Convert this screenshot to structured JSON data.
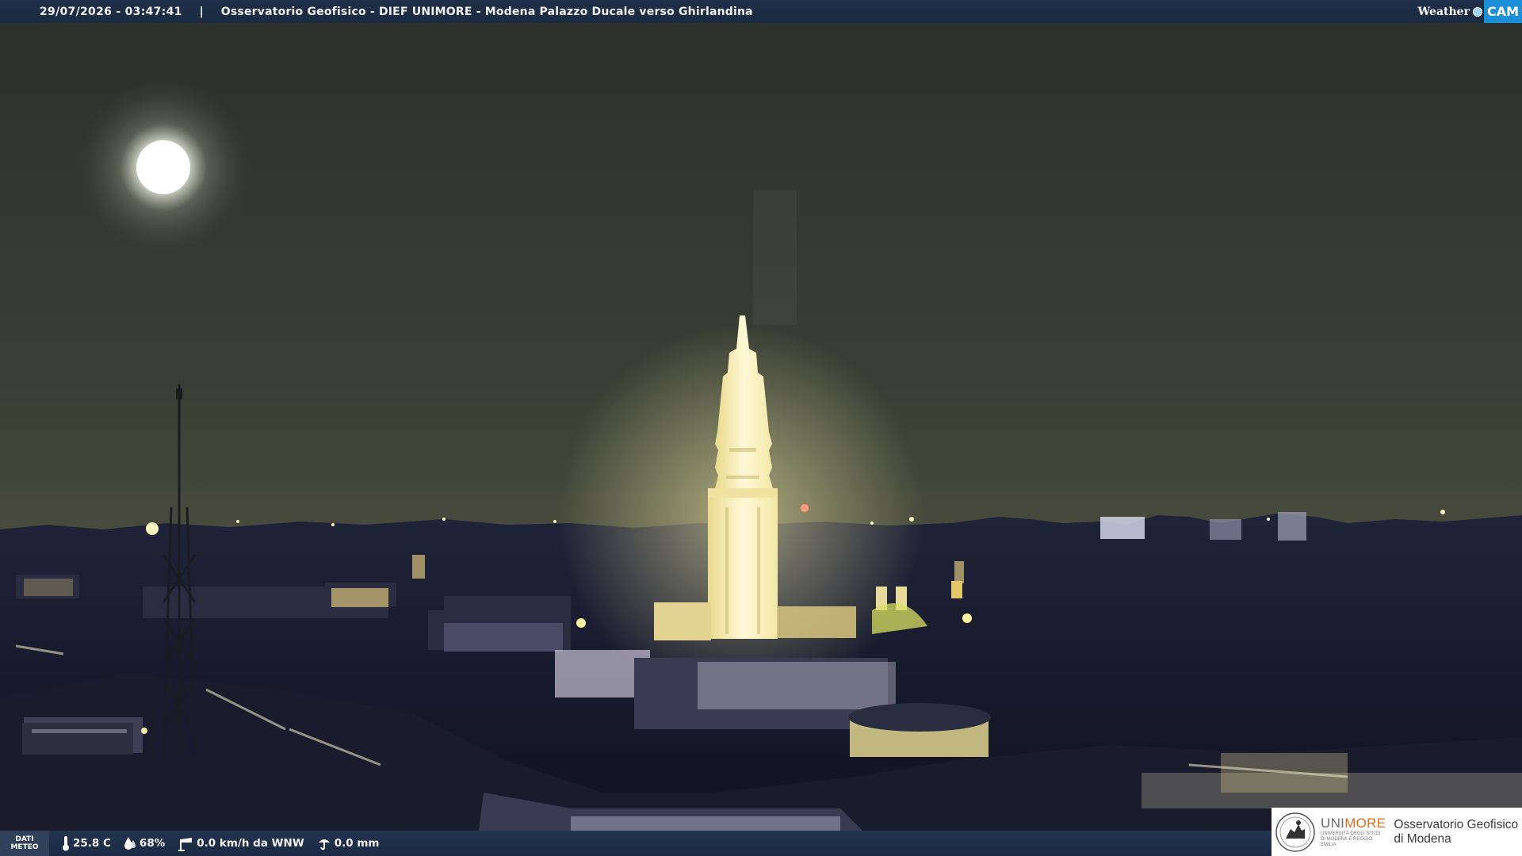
{
  "header": {
    "timestamp": "29/07/2026 - 03:47:41",
    "separator": "|",
    "title": "Osservatorio Geofisico - DIEF UNIMORE - Modena Palazzo Ducale verso Ghirlandina"
  },
  "brand": {
    "weather_text": "Weather",
    "cam_text": "CAM"
  },
  "weather": {
    "label_line1": "DATI",
    "label_line2": "METEO",
    "temperature": "25.8 C",
    "humidity": "68%",
    "wind": "0.0 km/h da WNW",
    "rain": "0.0 mm",
    "icons": [
      "thermometer-icon",
      "humidity-drop-icon",
      "wind-icon",
      "rain-gauge-icon"
    ]
  },
  "institution": {
    "name_part1": "UNI",
    "name_part2": "MORE",
    "subtitle": "UNIVERSITÀ DEGLI STUDI DI MODENA E REGGIO EMILIA",
    "observatory_line1": "Osservatorio Geofisico",
    "observatory_line2": "di Modena"
  },
  "colors": {
    "sky": "#3a4034",
    "bar": "#1f2f47",
    "tower_light": "#fff3c4",
    "cam_blue": "#1c8fd9",
    "unimore_orange": "#e86b1c"
  }
}
